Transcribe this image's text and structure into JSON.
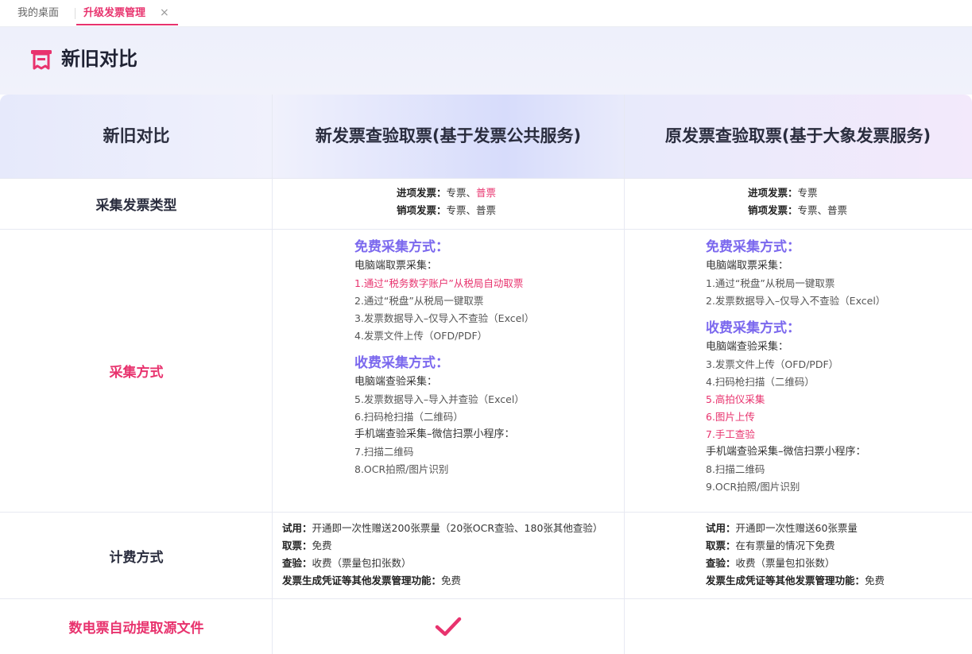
{
  "tabs": {
    "home": "我的桌面",
    "active": "升级发票管理",
    "close": "×"
  },
  "header": {
    "title": "新旧对比"
  },
  "table": {
    "headers": [
      "新旧对比",
      "新发票查验取票(基于发票公共服务)",
      "原发票查验取票(基于大象发票服务)"
    ],
    "rows": {
      "types": {
        "label": "采集发票类型",
        "new": {
          "in_label": "进项发票：",
          "in_value": "专票、",
          "in_value_hl": "普票",
          "out_label": "销项发票：",
          "out_value": "专票、普票"
        },
        "old": {
          "in_label": "进项发票：",
          "in_value": "专票",
          "out_label": "销项发票：",
          "out_value": "专票、普票"
        }
      },
      "method": {
        "label": "采集方式",
        "new": {
          "free_title": "免费采集方式：",
          "free_sub": "电脑端取票采集：",
          "free_items": [
            "1.通过“税务数字账户”从税局自动取票",
            "2.通过“税盘”从税局一键取票",
            "3.发票数据导入–仅导入不查验（Excel）",
            "4.发票文件上传（OFD/PDF）"
          ],
          "paid_title": "收费采集方式：",
          "paid_sub": "电脑端查验采集：",
          "paid_items": [
            "5.发票数据导入–导入并查验（Excel）",
            "6.扫码枪扫描（二维码）"
          ],
          "mobile_sub": "手机端查验采集–微信扫票小程序：",
          "mobile_items": [
            "7.扫描二维码",
            "8.OCR拍照/图片识别"
          ]
        },
        "old": {
          "free_title": "免费采集方式：",
          "free_sub": "电脑端取票采集：",
          "free_items": [
            "1.通过“税盘”从税局一键取票",
            "2.发票数据导入–仅导入不查验（Excel）"
          ],
          "paid_title": "收费采集方式：",
          "paid_sub": "电脑端查验采集：",
          "paid_items": [
            "3.发票文件上传（OFD/PDF）",
            "4.扫码枪扫描（二维码）",
            "5.高拍仪采集",
            "6.图片上传",
            "7.手工查验"
          ],
          "mobile_sub": "手机端查验采集–微信扫票小程序：",
          "mobile_items": [
            "8.扫描二维码",
            "9.OCR拍照/图片识别"
          ]
        }
      },
      "billing": {
        "label": "计费方式",
        "new": [
          {
            "k": "试用：",
            "v": "开通即一次性赠送200张票量（20张OCR查验、180张其他查验）"
          },
          {
            "k": "取票：",
            "v": "免费"
          },
          {
            "k": "查验：",
            "v": "收费（票量包扣张数）"
          },
          {
            "k": "发票生成凭证等其他发票管理功能：",
            "v": "免费"
          }
        ],
        "old": [
          {
            "k": "试用：",
            "v": "开通即一次性赠送60张票量"
          },
          {
            "k": "取票：",
            "v": "在有票量的情况下免费"
          },
          {
            "k": "查验：",
            "v": "收费（票量包扣张数）"
          },
          {
            "k": "发票生成凭证等其他发票管理功能：",
            "v": "免费"
          }
        ]
      },
      "source": {
        "label": "数电票自动提取源文件",
        "new_icon": "check-icon"
      }
    }
  },
  "colors": {
    "accent": "#e8336e",
    "purple": "#7b68ee"
  }
}
